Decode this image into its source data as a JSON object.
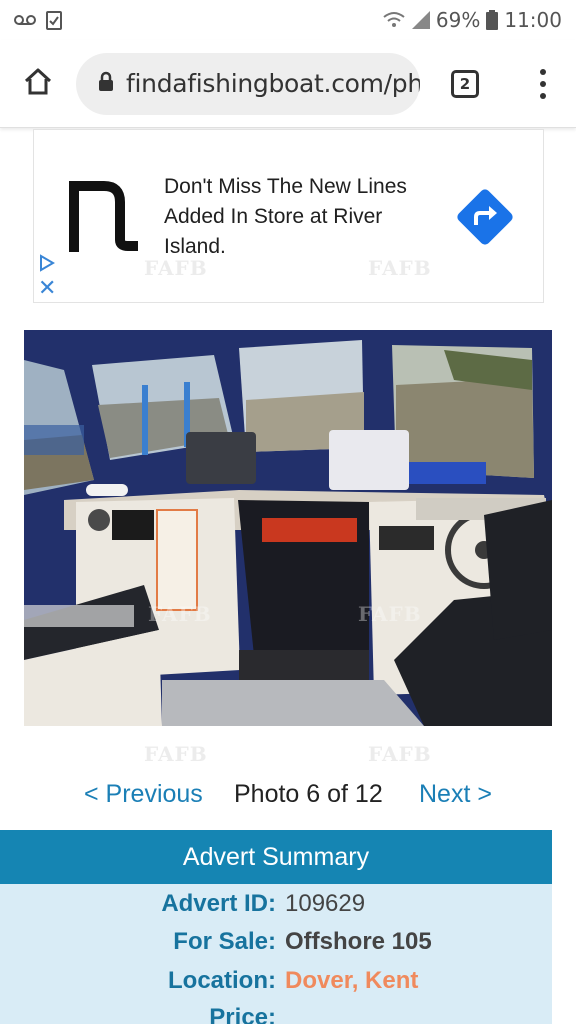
{
  "status_bar": {
    "battery": "69%",
    "time": "11:00",
    "icons": [
      "voicemail-icon",
      "clipboard-check-icon",
      "wifi-icon",
      "signal-icon",
      "battery-icon"
    ]
  },
  "browser": {
    "url": "findafishingboat.com/ph",
    "tab_count": "2"
  },
  "ad": {
    "headline": "Don't Miss The New Lines Added In Store at River Island.",
    "close_glyph": "✕",
    "brand_color": "#1a73e8"
  },
  "watermarks": [
    "FAFB",
    "FAFB",
    "FAFB",
    "FAFB"
  ],
  "gallery": {
    "previous": "< Previous",
    "count": "Photo 6 of 12",
    "next": "Next >"
  },
  "summary": {
    "title": "Advert Summary",
    "rows": [
      {
        "label": "Advert ID:",
        "value": "109629"
      },
      {
        "label": "For Sale:",
        "value": "Offshore 105"
      },
      {
        "label": "Location:",
        "value": "Dover, Kent"
      },
      {
        "label": "Price:",
        "value": ""
      }
    ],
    "colors": {
      "header": "#1585b3",
      "label": "#17739e",
      "location": "#f08a5d",
      "body": "#d9ecf6"
    }
  }
}
